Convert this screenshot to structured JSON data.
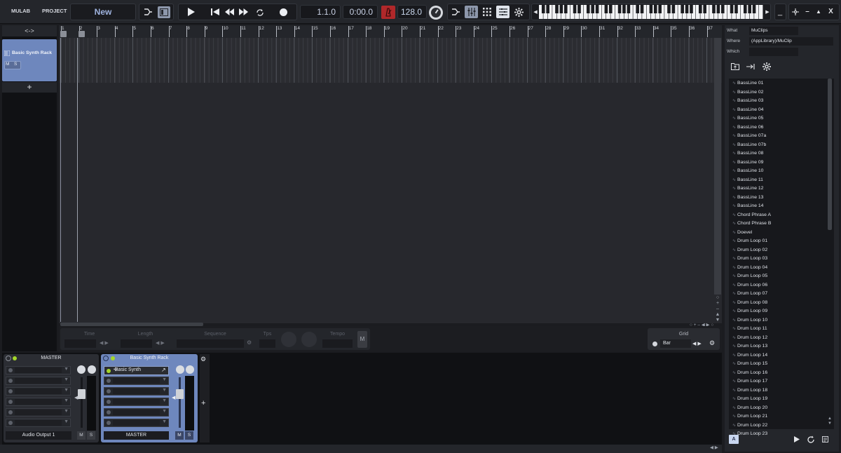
{
  "topbar": {
    "app_label": "MULAB",
    "project_label": "PROJECT",
    "project_name": "New",
    "position": "1.1.0",
    "time": "0:00.0",
    "tempo": "128.0",
    "window_min": "_",
    "window_min2": "–",
    "window_max": "▲",
    "window_close": "X"
  },
  "tracks": {
    "expand_label": "<->",
    "track_name": "Basic Synth Rack",
    "mute": "M",
    "solo": "S",
    "add_label": "+"
  },
  "ruler": {
    "marks": [
      "1",
      "2",
      "3",
      "4",
      "5",
      "6",
      "7",
      "8",
      "9",
      "10",
      "11",
      "12",
      "13",
      "14",
      "15",
      "16",
      "17",
      "18",
      "19",
      "20",
      "21",
      "22",
      "23",
      "24",
      "25",
      "26",
      "27",
      "28",
      "29",
      "30",
      "31",
      "32",
      "33",
      "34",
      "35",
      "36",
      "37"
    ]
  },
  "position_bar": {
    "time_label": "Time",
    "length_label": "Length",
    "sequence_label": "Sequence",
    "tps_label": "Tps",
    "tempo_label": "Tempo",
    "m_label": "M",
    "grid_label": "Grid",
    "grid_value": "Bar"
  },
  "mixer": {
    "master": {
      "title": "MASTER",
      "output": "Audio Output 1",
      "mute": "M",
      "solo": "S"
    },
    "rack": {
      "title": "Basic Synth Rack",
      "plugin": "Basic Synth",
      "output": "MASTER",
      "mute": "M",
      "solo": "S"
    },
    "add_label": "+"
  },
  "browser": {
    "what_label": "What",
    "what_value": "MuClips",
    "where_label": "Where",
    "where_value": "(AppLibrary)/MuClip",
    "which_label": "Which",
    "which_value": "",
    "files": [
      "BassLine 01",
      "BassLine 02",
      "BassLine 03",
      "BassLine 04",
      "BassLine 05",
      "BassLine 06",
      "BassLine 07a",
      "BassLine 07b",
      "BassLine 08",
      "BassLine 09",
      "BassLine 10",
      "BassLine 11",
      "BassLine 12",
      "BassLine 13",
      "BassLine 14",
      "Chord Phrase A",
      "Chord Phrase B",
      "Doevel",
      "Drum Loop 01",
      "Drum Loop 02",
      "Drum Loop 03",
      "Drum Loop 04",
      "Drum Loop 05",
      "Drum Loop 06",
      "Drum Loop 07",
      "Drum Loop 08",
      "Drum Loop 09",
      "Drum Loop 10",
      "Drum Loop 11",
      "Drum Loop 12",
      "Drum Loop 13",
      "Drum Loop 14",
      "Drum Loop 15",
      "Drum Loop 16",
      "Drum Loop 17",
      "Drum Loop 18",
      "Drum Loop 19",
      "Drum Loop 20",
      "Drum Loop 21",
      "Drum Loop 22",
      "Drum Loop 23"
    ],
    "a_button": "A"
  },
  "colors": {
    "accent": "#6e87bd",
    "record_red": "#b0282a",
    "led_green": "#a4d62a"
  }
}
